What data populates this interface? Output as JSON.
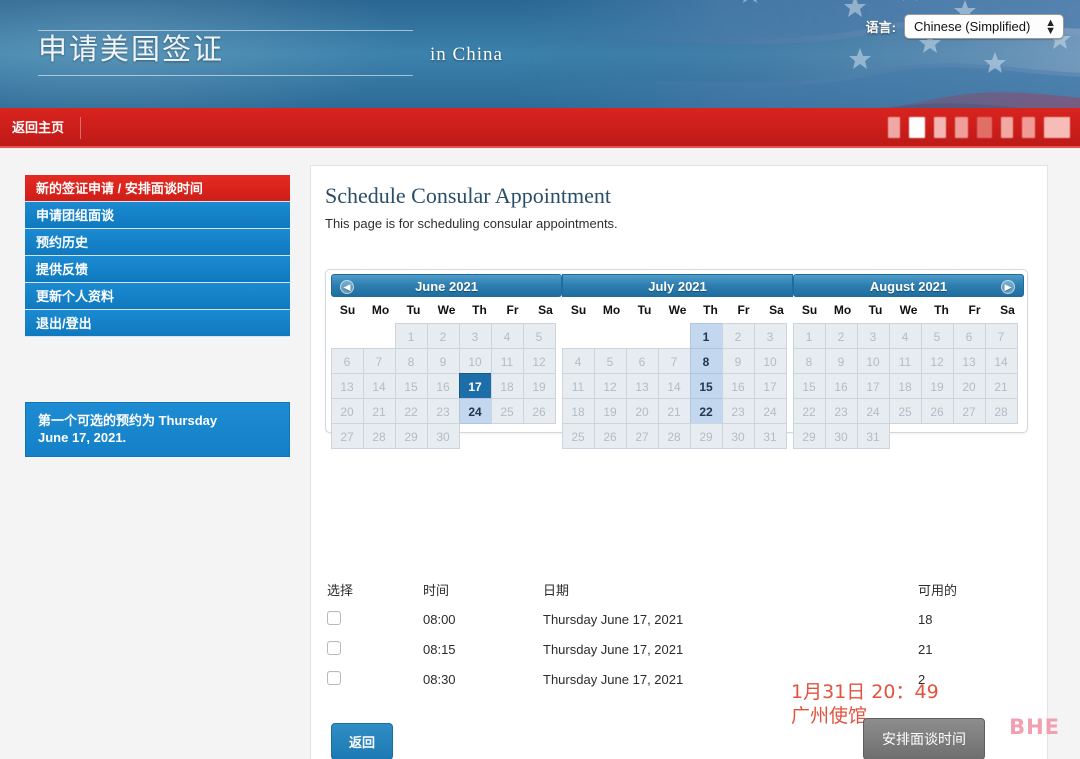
{
  "header": {
    "title_cn": "申请美国签证",
    "subtitle_en": "in  China",
    "language_label": "语言:",
    "language_value": "Chinese (Simplified)",
    "select_arrows": "⬍",
    "flag_alt": "us-flag-graphic"
  },
  "navbar": {
    "home_label": "返回主页",
    "obscured_blocks": [
      {
        "w": 12,
        "c": "#f0a8a4"
      },
      {
        "w": 16,
        "c": "#fdfdfd"
      },
      {
        "w": 12,
        "c": "#f4b6b2"
      },
      {
        "w": 13,
        "c": "#ef9e99"
      },
      {
        "w": 15,
        "c": "#e26e68"
      },
      {
        "w": 12,
        "c": "#f2a9a4"
      },
      {
        "w": 13,
        "c": "#f09b96"
      },
      {
        "w": 26,
        "c": "#f7bcb8"
      }
    ]
  },
  "sidebar": {
    "items": [
      {
        "label": "新的签证申请 / 安排面谈时间",
        "active": true,
        "name": "sidebar-item-new-application"
      },
      {
        "label": "申请团组面谈",
        "active": false,
        "name": "sidebar-item-group-interview"
      },
      {
        "label": "预约历史",
        "active": false,
        "name": "sidebar-item-appointment-history"
      },
      {
        "label": "提供反馈",
        "active": false,
        "name": "sidebar-item-feedback"
      },
      {
        "label": "更新个人资料",
        "active": false,
        "name": "sidebar-item-update-profile"
      },
      {
        "label": "退出/登出",
        "active": false,
        "name": "sidebar-item-logout"
      }
    ],
    "info_line1": "第一个可选的预约为 Thursday",
    "info_line2": "June 17, 2021."
  },
  "main": {
    "page_title": "Schedule Consular Appointment",
    "page_subtitle": "This page is for scheduling consular appointments.",
    "dow": [
      "Su",
      "Mo",
      "Tu",
      "We",
      "Th",
      "Fr",
      "Sa"
    ],
    "prev_arrow": "◀",
    "next_arrow": "▶",
    "calendars": [
      {
        "title": "June 2021",
        "has_prev": true,
        "has_next": false,
        "weeks": [
          [
            null,
            null,
            {
              "d": 1
            },
            {
              "d": 2
            },
            {
              "d": 3
            },
            {
              "d": 4
            },
            {
              "d": 5
            }
          ],
          [
            {
              "d": 6
            },
            {
              "d": 7
            },
            {
              "d": 8
            },
            {
              "d": 9
            },
            {
              "d": 10
            },
            {
              "d": 11
            },
            {
              "d": 12
            }
          ],
          [
            {
              "d": 13
            },
            {
              "d": 14
            },
            {
              "d": 15
            },
            {
              "d": 16
            },
            {
              "d": 17,
              "state": "selected"
            },
            {
              "d": 18
            },
            {
              "d": 19
            }
          ],
          [
            {
              "d": 20
            },
            {
              "d": 21
            },
            {
              "d": 22
            },
            {
              "d": 23
            },
            {
              "d": 24,
              "state": "avail"
            },
            {
              "d": 25
            },
            {
              "d": 26
            }
          ],
          [
            {
              "d": 27
            },
            {
              "d": 28
            },
            {
              "d": 29
            },
            {
              "d": 30
            },
            null,
            null,
            null
          ]
        ]
      },
      {
        "title": "July 2021",
        "has_prev": false,
        "has_next": false,
        "weeks": [
          [
            null,
            null,
            null,
            null,
            {
              "d": 1,
              "state": "avail"
            },
            {
              "d": 2
            },
            {
              "d": 3
            }
          ],
          [
            {
              "d": 4
            },
            {
              "d": 5
            },
            {
              "d": 6
            },
            {
              "d": 7
            },
            {
              "d": 8,
              "state": "avail"
            },
            {
              "d": 9
            },
            {
              "d": 10
            }
          ],
          [
            {
              "d": 11
            },
            {
              "d": 12
            },
            {
              "d": 13
            },
            {
              "d": 14
            },
            {
              "d": 15,
              "state": "avail"
            },
            {
              "d": 16
            },
            {
              "d": 17
            }
          ],
          [
            {
              "d": 18
            },
            {
              "d": 19
            },
            {
              "d": 20
            },
            {
              "d": 21
            },
            {
              "d": 22,
              "state": "avail"
            },
            {
              "d": 23
            },
            {
              "d": 24
            }
          ],
          [
            {
              "d": 25
            },
            {
              "d": 26
            },
            {
              "d": 27
            },
            {
              "d": 28
            },
            {
              "d": 29
            },
            {
              "d": 30
            },
            {
              "d": 31
            }
          ]
        ]
      },
      {
        "title": "August 2021",
        "has_prev": false,
        "has_next": true,
        "weeks": [
          [
            {
              "d": 1
            },
            {
              "d": 2
            },
            {
              "d": 3
            },
            {
              "d": 4
            },
            {
              "d": 5
            },
            {
              "d": 6
            },
            {
              "d": 7
            }
          ],
          [
            {
              "d": 8
            },
            {
              "d": 9
            },
            {
              "d": 10
            },
            {
              "d": 11
            },
            {
              "d": 12
            },
            {
              "d": 13
            },
            {
              "d": 14
            }
          ],
          [
            {
              "d": 15
            },
            {
              "d": 16
            },
            {
              "d": 17
            },
            {
              "d": 18
            },
            {
              "d": 19
            },
            {
              "d": 20
            },
            {
              "d": 21
            }
          ],
          [
            {
              "d": 22
            },
            {
              "d": 23
            },
            {
              "d": 24
            },
            {
              "d": 25
            },
            {
              "d": 26
            },
            {
              "d": 27
            },
            {
              "d": 28
            }
          ],
          [
            {
              "d": 29
            },
            {
              "d": 30
            },
            {
              "d": 31
            },
            null,
            null,
            null,
            null
          ]
        ]
      }
    ],
    "overlay_line1": "1月31日 20：49",
    "overlay_line2": "广州使馆",
    "table": {
      "headers": {
        "select": "选择",
        "time": "时间",
        "date": "日期",
        "available": "可用的"
      },
      "rows": [
        {
          "time": "08:00",
          "date": "Thursday June 17, 2021",
          "available": "18",
          "checked": false
        },
        {
          "time": "08:15",
          "date": "Thursday June 17, 2021",
          "available": "21",
          "checked": false
        },
        {
          "time": "08:30",
          "date": "Thursday June 17, 2021",
          "available": "2",
          "checked": false
        }
      ]
    },
    "back_button": "返回",
    "schedule_button": "安排面谈时间",
    "watermark": "BHE"
  },
  "colors": {
    "brand_red": "#cf1d17",
    "brand_blue": "#1380c7",
    "cal_selected": "#1d6ea8",
    "cal_available": "#c3d7ee",
    "overlay_red": "#e2523e",
    "watermark_pink": "#f0a0b0"
  }
}
